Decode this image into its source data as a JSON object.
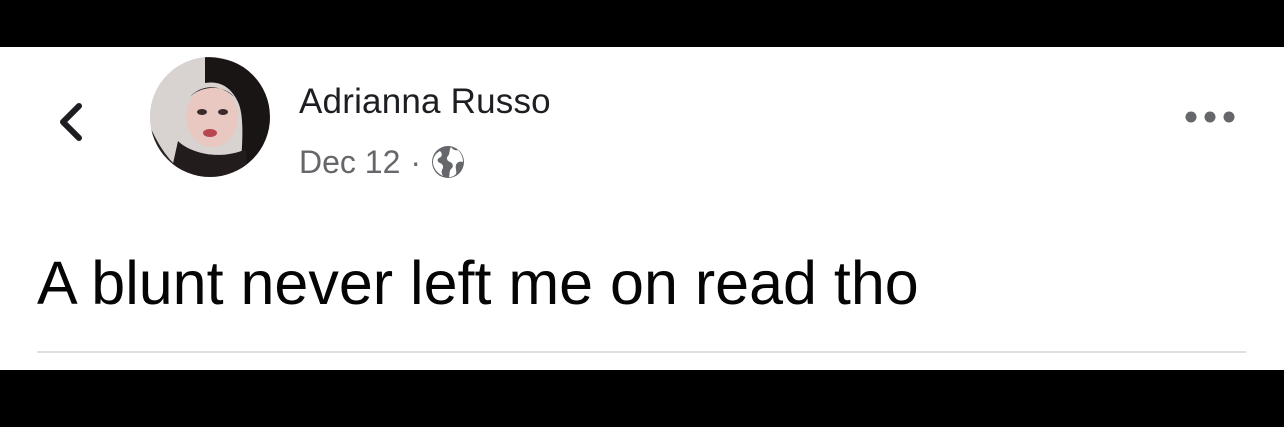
{
  "post": {
    "author_name": "Adrianna Russo",
    "date": "Dec 12",
    "separator": "·",
    "privacy_icon": "globe-icon",
    "text": "A blunt never left me on read tho"
  },
  "navigation": {
    "back_icon": "chevron-left-icon",
    "more_icon": "more-horizontal-icon"
  },
  "colors": {
    "background": "#ffffff",
    "letterbox": "#000000",
    "primary_text": "#1c1e21",
    "secondary_text": "#65676b",
    "divider": "#dddfe2"
  }
}
